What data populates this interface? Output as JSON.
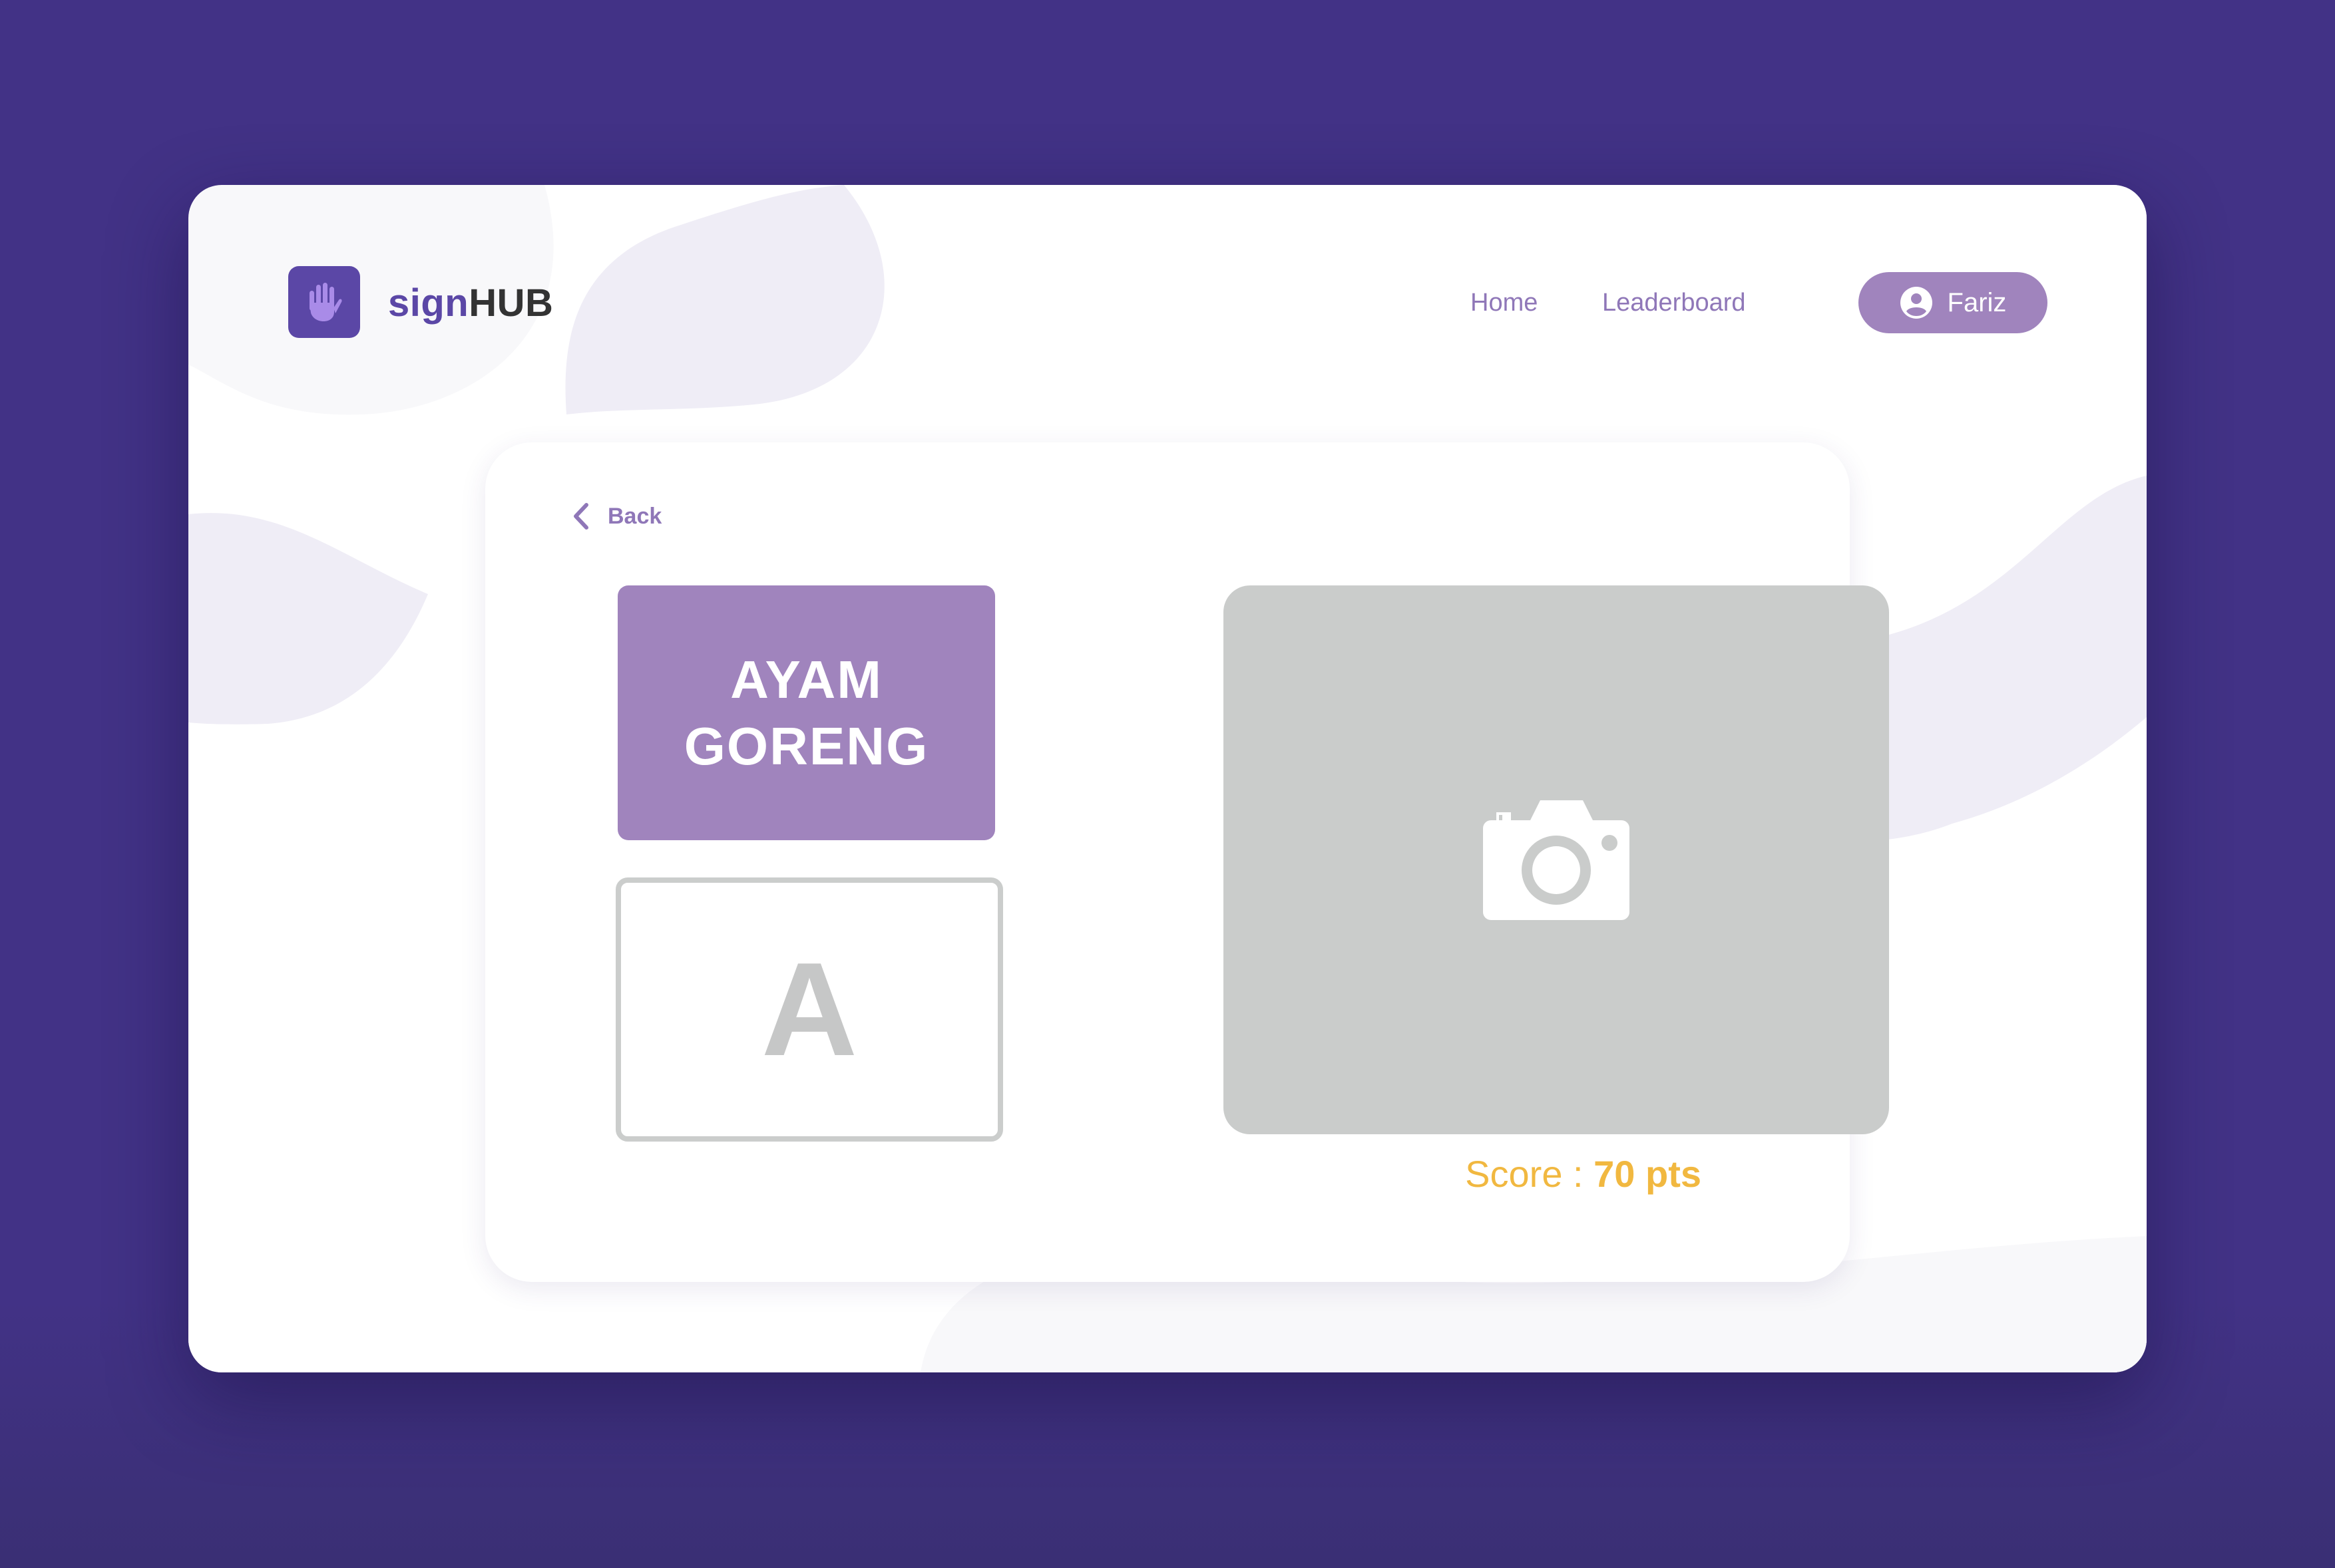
{
  "colors": {
    "background": "#423286",
    "brand": "#5b47a6",
    "accent": "#a084bd",
    "nav_text": "#8f77b8",
    "score": "#f1b840",
    "placeholder_gray": "#cacccb"
  },
  "header": {
    "logo_icon": "hand-icon",
    "brand_part1": "sign",
    "brand_part2": "HUB",
    "nav": {
      "home": "Home",
      "leaderboard": "Leaderboard"
    },
    "user": {
      "icon": "user-circle-icon",
      "name": "Fariz"
    }
  },
  "main": {
    "back_icon": "chevron-left-icon",
    "back_label": "Back",
    "word_line1": "AYAM",
    "word_line2": "GORENG",
    "letter": "A",
    "camera_icon": "camera-icon",
    "score_label": "Score : ",
    "score_value": "70 pts"
  }
}
